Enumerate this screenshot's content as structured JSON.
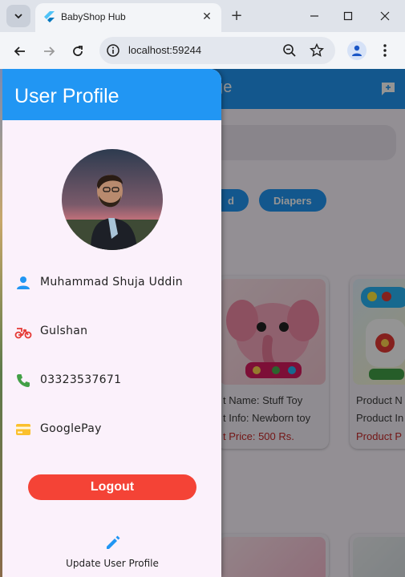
{
  "browser": {
    "tab_title": "BabyShop Hub",
    "url": "localhost:59244",
    "new_tab_glyph": "+",
    "close_tab_glyph": "✕"
  },
  "background_page": {
    "appbar_title_fragment": "age",
    "chips": [
      "d",
      "Diapers"
    ],
    "cards": [
      {
        "line1": "t Name: Stuff Toy",
        "line2": "t Info: Newborn toy",
        "price": "t Price: 500 Rs."
      },
      {
        "line1": "Product N",
        "line2": "Product In",
        "price": "Product P"
      }
    ]
  },
  "drawer": {
    "title": "User Profile",
    "name": "Muhammad Shuja Uddin",
    "address": "Gulshan",
    "phone": "03323537671",
    "payment": "GooglePay",
    "logout_label": "Logout",
    "update_label": "Update User Profile"
  },
  "colors": {
    "primary": "#2196f3",
    "logout": "#f44336",
    "person_icon": "#2196f3",
    "bike_icon": "#e53935",
    "phone_icon": "#43a047",
    "card_icon": "#fbc02d",
    "edit_icon": "#2196f3",
    "price_text": "#c62828"
  },
  "icons": {
    "tab_search": "chevron-down-icon",
    "favicon": "flutter-icon",
    "back": "arrow-left-icon",
    "forward": "arrow-right-icon",
    "reload": "reload-icon",
    "site_info": "info-icon",
    "zoom": "zoom-out-icon",
    "bookmark": "star-icon",
    "profile": "person-icon",
    "menu": "kebab-menu-icon",
    "minimize": "minimize-icon",
    "maximize": "maximize-icon",
    "close": "close-icon",
    "appbar_action": "feedback-icon",
    "name": "person-icon",
    "address": "delivery-bike-icon",
    "phone": "phone-icon",
    "payment": "credit-card-icon",
    "edit": "pencil-icon"
  }
}
